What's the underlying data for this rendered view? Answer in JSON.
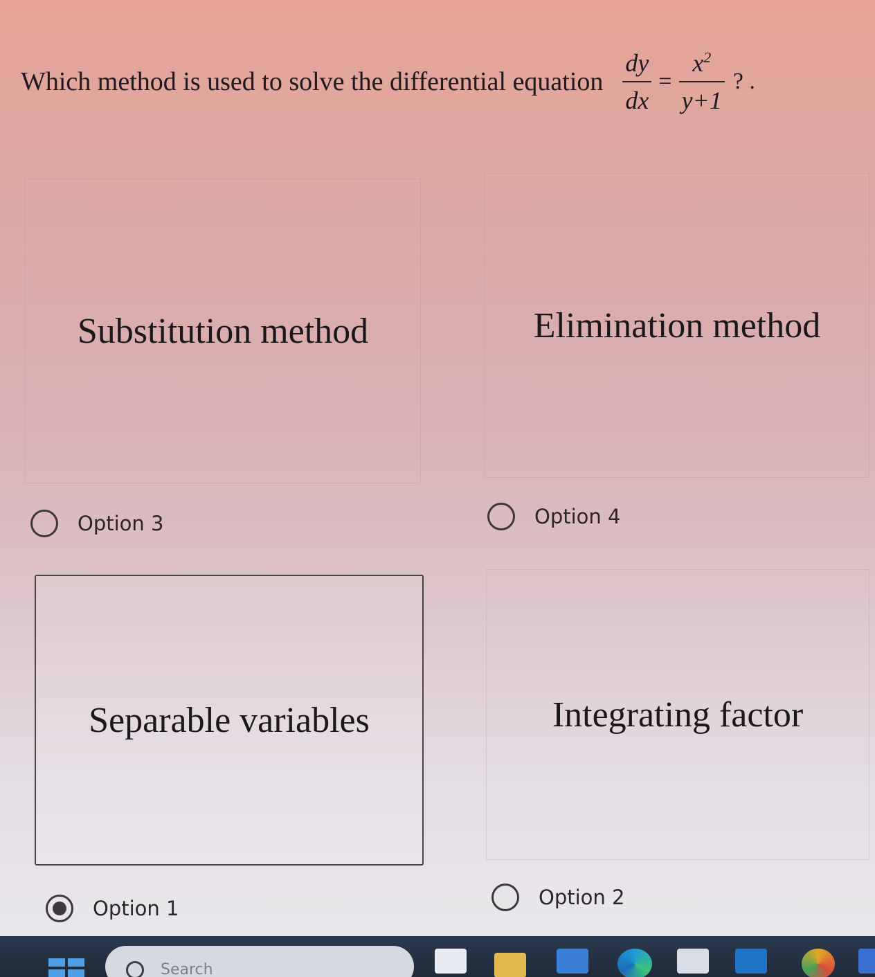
{
  "question": {
    "text": "Which method is used to solve the differential equation",
    "numerator": "dy",
    "denominator": "dx",
    "equals": "=",
    "rhs_numerator_base": "x",
    "rhs_numerator_exp": "2",
    "rhs_denominator": "y+1",
    "tail": "? ."
  },
  "answers": [
    {
      "card_text": "Substitution method",
      "option_label": "Option 3",
      "selected": false
    },
    {
      "card_text": "Elimination method",
      "option_label": "Option 4",
      "selected": false
    },
    {
      "card_text": "Separable variables",
      "option_label": "Option 1",
      "selected": true
    },
    {
      "card_text": "Integrating factor",
      "option_label": "Option 2",
      "selected": false
    }
  ],
  "taskbar": {
    "search_placeholder": "Search",
    "apps": [
      "windows-start-icon",
      "search-icon",
      "file-explorer-icon",
      "folder-icon",
      "store-icon",
      "edge-icon",
      "calendar-icon",
      "outlook-icon",
      "chrome-icon",
      "word-icon"
    ]
  },
  "colors": {
    "taskbar": "#1f2a3a",
    "radio": "#3c383c",
    "text": "#1e1a1e"
  }
}
